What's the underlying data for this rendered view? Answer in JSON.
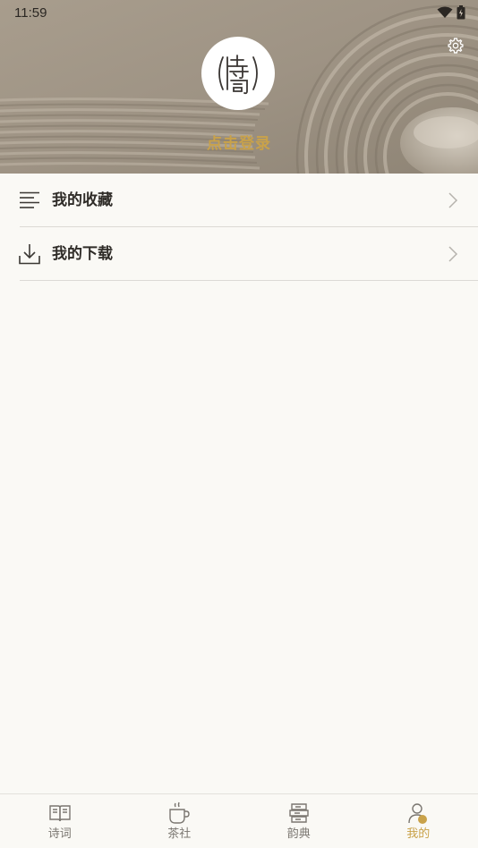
{
  "status_bar": {
    "time": "11:59",
    "icons": [
      "wifi-icon",
      "battery-icon"
    ]
  },
  "header": {
    "settings_icon": "gear-icon",
    "avatar_icon": "poetry-seal-logo",
    "login_text": "点击登录"
  },
  "menu": {
    "items": [
      {
        "label": "我的收藏",
        "icon": "list-lines-icon"
      },
      {
        "label": "我的下载",
        "icon": "download-icon"
      }
    ]
  },
  "bottom_nav": {
    "items": [
      {
        "label": "诗词",
        "icon": "open-book-icon",
        "active": false
      },
      {
        "label": "茶社",
        "icon": "tea-cup-icon",
        "active": false
      },
      {
        "label": "韵典",
        "icon": "stacked-books-icon",
        "active": false
      },
      {
        "label": "我的",
        "icon": "person-icon",
        "active": true
      }
    ]
  },
  "colors": {
    "accent": "#c9a24a",
    "background": "#faf9f5",
    "text": "#2f2c28",
    "muted": "#7a7670"
  }
}
